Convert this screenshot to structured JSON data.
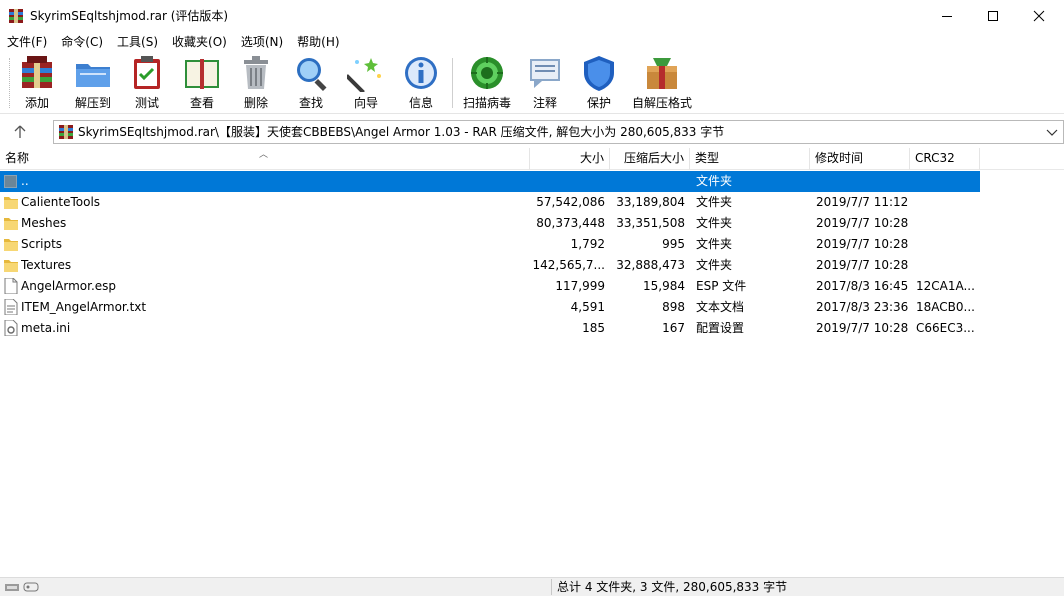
{
  "window": {
    "title": "SkyrimSEqltshjmod.rar (评估版本)",
    "controls": [
      "minimize",
      "maximize",
      "close"
    ]
  },
  "menu": [
    "文件(F)",
    "命令(C)",
    "工具(S)",
    "收藏夹(O)",
    "选项(N)",
    "帮助(H)"
  ],
  "toolbar": [
    {
      "label": "添加",
      "icon": "add-archive-icon"
    },
    {
      "label": "解压到",
      "icon": "extract-folder-icon"
    },
    {
      "label": "测试",
      "icon": "test-clipboard-icon"
    },
    {
      "label": "查看",
      "icon": "view-book-icon"
    },
    {
      "label": "删除",
      "icon": "trash-icon"
    },
    {
      "label": "查找",
      "icon": "magnifier-icon"
    },
    {
      "label": "向导",
      "icon": "wizard-wand-icon"
    },
    {
      "label": "信息",
      "icon": "info-icon"
    },
    {
      "label": "扫描病毒",
      "icon": "virus-scan-icon"
    },
    {
      "label": "注释",
      "icon": "comment-icon"
    },
    {
      "label": "保护",
      "icon": "shield-icon"
    },
    {
      "label": "自解压格式",
      "icon": "sfx-box-icon"
    }
  ],
  "address": {
    "path": "SkyrimSEqltshjmod.rar\\【服装】天使套CBBEBS\\Angel Armor 1.03 - RAR 压缩文件, 解包大小为 280,605,833 字节"
  },
  "columns": [
    "名称",
    "大小",
    "压缩后大小",
    "类型",
    "修改时间",
    "CRC32"
  ],
  "files": [
    {
      "name": "..",
      "size": "",
      "packed": "",
      "type": "文件夹",
      "modified": "",
      "crc": "",
      "kind": "parent",
      "selected": true
    },
    {
      "name": "CalienteTools",
      "size": "57,542,086",
      "packed": "33,189,804",
      "type": "文件夹",
      "modified": "2019/7/7 11:12",
      "crc": "",
      "kind": "folder"
    },
    {
      "name": "Meshes",
      "size": "80,373,448",
      "packed": "33,351,508",
      "type": "文件夹",
      "modified": "2019/7/7 10:28",
      "crc": "",
      "kind": "folder"
    },
    {
      "name": "Scripts",
      "size": "1,792",
      "packed": "995",
      "type": "文件夹",
      "modified": "2019/7/7 10:28",
      "crc": "",
      "kind": "folder"
    },
    {
      "name": "Textures",
      "size": "142,565,7...",
      "packed": "32,888,473",
      "type": "文件夹",
      "modified": "2019/7/7 10:28",
      "crc": "",
      "kind": "folder"
    },
    {
      "name": "AngelArmor.esp",
      "size": "117,999",
      "packed": "15,984",
      "type": "ESP 文件",
      "modified": "2017/8/3 16:45",
      "crc": "12CA1A...",
      "kind": "file"
    },
    {
      "name": "ITEM_AngelArmor.txt",
      "size": "4,591",
      "packed": "898",
      "type": "文本文档",
      "modified": "2017/8/3 23:36",
      "crc": "18ACB0...",
      "kind": "text"
    },
    {
      "name": "meta.ini",
      "size": "185",
      "packed": "167",
      "type": "配置设置",
      "modified": "2019/7/7 10:28",
      "crc": "C66EC3...",
      "kind": "ini"
    }
  ],
  "status": {
    "summary": "总计 4 文件夹, 3 文件, 280,605,833 字节"
  },
  "colors": {
    "selection": "#0078d7",
    "folder": "#f3c74a"
  }
}
